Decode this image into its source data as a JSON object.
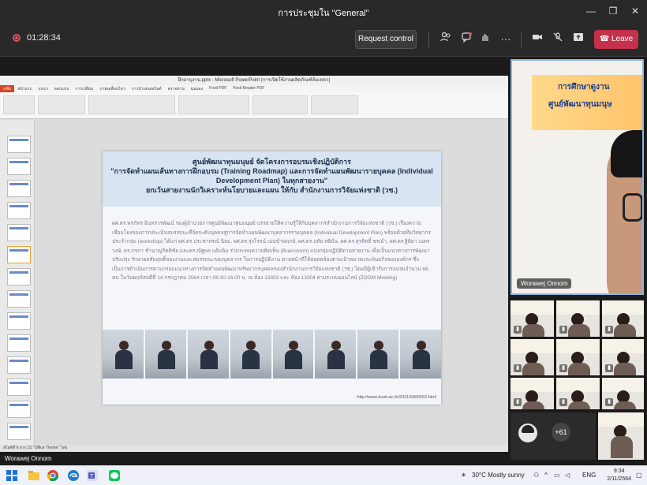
{
  "window": {
    "title": "การประชุมใน \"General\"",
    "minimize_glyph": "—",
    "maximize_glyph": "❐",
    "close_glyph": "✕"
  },
  "toolbar": {
    "timer": "01:28:34",
    "request_control_label": "Request control",
    "leave_label": "Leave",
    "icons": [
      "people-icon",
      "chat-icon",
      "raise-hand-icon",
      "more-icon",
      "camera-icon",
      "mic-off-icon",
      "share-icon"
    ],
    "leave_color": "#c4314b"
  },
  "ppt": {
    "title": "ฝึกอาบุงาน.pptx - Microsoft PowerPoint (การเปิดใช้งานผลิตภัณฑ์ล้มเหลว)",
    "tabs": [
      "แฟ้ม",
      "หน้าแรก",
      "แทรก",
      "ออกแบบ",
      "การเปลี่ยน",
      "ภาพเคลื่อนไหว",
      "การนำเสนอสไลด์",
      "ตรวจทาน",
      "มุมมอง",
      "Foxit PDF",
      "Foxit Reader PDF"
    ],
    "status_text": "สไลด์ที่ 6 จาก 31   \"Office Theme\"   ไทย"
  },
  "slide": {
    "header_lines": [
      "ศูนย์พัฒนาทุนมนุษย์ จัดโครงการอบรมเชิงปฏิบัติการ",
      "\"การจัดทำแผนเส้นทางการฝึกอบรม (Training Roadmap) และการจัดทำแผนพัฒนารายบุคคล (Individual",
      "Development Plan) ในทุกสายงาน\"",
      "ยกเว้นสายงานนักวิเคราะห์นโยบายและแผน ให้กับ สำนักงานการวิจัยแห่งชาติ (วช.)"
    ],
    "body": "ผศ.ดร.พรภัทร อินทรวรพัฒน์ รองผู้อำนวยการศูนย์พัฒนาทุนมนุษย์ บรรยายให้ความรู้ให้กับบุคลากรสำนักงานการวิจัยแห่งชาติ (วช.) เรื่องความเชื่อมโยงของการประเมินสมรรถนะที่จัดระดับบุคคลสู่การจัดทำแผนพัฒนาบุคลากรรายบุคคล (Individual Development Plan) พร้อมด้วยทีมวิทยากรประจำกลุ่ม (workshop) ได้แก่ ผศ.ดร.ประชาสรณ์ นิยม, ผศ.ดร.รุ่งโรจน์ เม่นขำพฤกษ์, ผศ.ดร.ฤทัย สติมั่น, ผศ.ดร.สุรสิทธิ์ ชรเม้า, ผศ.ดร.ฐิติยา เนตรวงษ์, ดร.ภรภา ชำนาญกิตติชัย และดร.ณัฐพล แย้มฉิม ร่วมระดมความคิดเห็น (Brainstorm) แบ่งกลุ่มปฏิบัติตามสายงาน เพื่อเป็นแนวทางการพัฒนาปรับปรุง รักษาผลสัมฤทธิ์ของงานและสมรรถนะของบุคลากร ในการปฏิบัติงาน ตามหน้าที่ให้สอดคล้องตามเป้าหมายและพันธกิจขององค์กร ซึ่งเป็นการดำเนินการตามกรอบแนวทางการจัดทำแผนพัฒนาทรัพยากรบุคคลของสำนักงานการวิจัยแห่งชาติ (วช.) โดยมีผู้เข้ารับการอบรมจำนวน 66 คน ในวันพฤหัสบดีที่ 14 กรกฎาคม 2564 เวลา 08.30-16.00 น. ณ ห้อง 13303 และ ห้อง 13304 ผ่านระบบออนไลน์ (ZOOM Meeting)",
    "url": "http://www.dusit.ac.th/2021/09/09/63.html",
    "photos_count": 8
  },
  "participants": {
    "presenter_name": "Worawej Onnom",
    "presenter_banner_line1": "การศึกษาดูงาน",
    "presenter_banner_line2": "ศูนย์พัฒนาทุนมนุษ",
    "overflow_count": "+61",
    "tile_count": 9
  },
  "bottom_name": "Worawej Onnom",
  "taskbar": {
    "weather": "30°C  Mostly sunny",
    "lang": "ENG",
    "time": "9:34",
    "date": "2/11/2564",
    "apps": [
      "windows-icon",
      "search-icon",
      "file-explorer-icon",
      "chrome-icon",
      "edge-icon",
      "teams-icon",
      "line-icon"
    ]
  }
}
